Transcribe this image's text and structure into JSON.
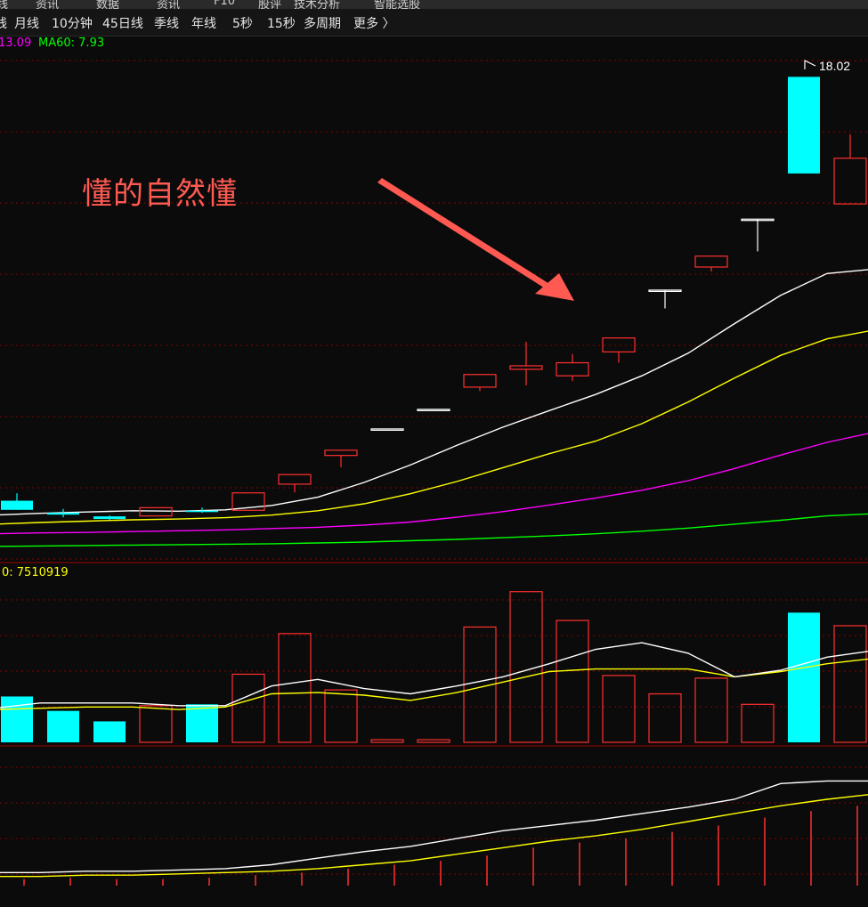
{
  "top_strip": [
    "线",
    "资讯",
    "数据",
    "资讯",
    "F10",
    "股评",
    "技术分析",
    "智能选股"
  ],
  "period_bar": {
    "items": [
      "线",
      "月线",
      "10分钟",
      "45日线",
      "季线",
      "年线",
      "5秒",
      "15秒",
      "多周期",
      "更多 〉"
    ]
  },
  "price_panel": {
    "ma_labels": [
      {
        "text": "13.09",
        "color": "#ff00ff"
      },
      {
        "text": "MA60: 7.93",
        "color": "#00ff00"
      }
    ],
    "high_label": "18.02",
    "annotation": "懂的自然懂"
  },
  "volume_panel": {
    "label": "0: 7510919",
    "label_color": "#ffff00"
  },
  "colors": {
    "up": "#ff3030",
    "down": "#00ffff",
    "ma_white": "#ffffff",
    "ma_yellow": "#ffff00",
    "ma_magenta": "#ff00ff",
    "ma_green": "#00ff00",
    "arrow": "#ff5a52",
    "grid": "#8a0000"
  },
  "chart_data": {
    "type": "candlestick",
    "candles": [
      {
        "o": 8.28,
        "h": 8.45,
        "l": 8.28,
        "c": 8.07,
        "dir": "down"
      },
      {
        "o": 8.0,
        "h": 8.09,
        "l": 7.9,
        "c": 7.96,
        "dir": "down"
      },
      {
        "o": 7.92,
        "h": 7.94,
        "l": 7.84,
        "c": 7.86,
        "dir": "down"
      },
      {
        "o": 7.93,
        "h": 8.12,
        "l": 7.93,
        "c": 8.12,
        "dir": "up"
      },
      {
        "o": 8.05,
        "h": 8.12,
        "l": 8.0,
        "c": 8.03,
        "dir": "down"
      },
      {
        "o": 8.06,
        "h": 8.46,
        "l": 8.06,
        "c": 8.46,
        "dir": "up"
      },
      {
        "o": 8.66,
        "h": 8.88,
        "l": 8.47,
        "c": 8.88,
        "dir": "up"
      },
      {
        "o": 9.32,
        "h": 9.44,
        "l": 9.05,
        "c": 9.44,
        "dir": "up"
      },
      {
        "o": 9.93,
        "h": 9.93,
        "l": 9.93,
        "c": 9.93,
        "dir": "flat"
      },
      {
        "o": 10.38,
        "h": 10.38,
        "l": 10.38,
        "c": 10.38,
        "dir": "flat"
      },
      {
        "o": 10.89,
        "h": 11.18,
        "l": 10.8,
        "c": 11.18,
        "dir": "up"
      },
      {
        "o": 11.3,
        "h": 11.93,
        "l": 10.93,
        "c": 11.38,
        "dir": "up"
      },
      {
        "o": 11.15,
        "h": 11.65,
        "l": 11.03,
        "c": 11.45,
        "dir": "up"
      },
      {
        "o": 11.7,
        "h": 12.02,
        "l": 11.45,
        "c": 12.02,
        "dir": "up"
      },
      {
        "o": 13.12,
        "h": 13.12,
        "l": 12.7,
        "c": 13.12,
        "dir": "flat"
      },
      {
        "o": 13.65,
        "h": 13.9,
        "l": 13.55,
        "c": 13.9,
        "dir": "up"
      },
      {
        "o": 14.75,
        "h": 14.75,
        "l": 14.01,
        "c": 14.75,
        "dir": "flat"
      },
      {
        "o": 18.02,
        "h": 18.02,
        "l": 15.8,
        "c": 15.8,
        "dir": "down"
      },
      {
        "o": 15.1,
        "h": 16.7,
        "l": 15.1,
        "c": 16.15,
        "dir": "up"
      }
    ],
    "ma_white": [
      7.95,
      7.99,
      8.02,
      8.05,
      8.04,
      8.07,
      8.17,
      8.36,
      8.7,
      9.1,
      9.55,
      9.97,
      10.35,
      10.72,
      11.15,
      11.67,
      12.35,
      13.0,
      13.5,
      13.6
    ],
    "ma_yellow": [
      7.74,
      7.78,
      7.81,
      7.84,
      7.86,
      7.89,
      7.95,
      8.05,
      8.21,
      8.44,
      8.72,
      9.04,
      9.36,
      9.65,
      10.05,
      10.55,
      11.1,
      11.62,
      12.0,
      12.2
    ],
    "ma_magenta": [
      7.52,
      7.54,
      7.55,
      7.57,
      7.59,
      7.61,
      7.64,
      7.67,
      7.72,
      7.79,
      7.9,
      8.03,
      8.18,
      8.34,
      8.52,
      8.74,
      9.02,
      9.33,
      9.62,
      9.85
    ],
    "ma_green": [
      7.23,
      7.24,
      7.25,
      7.26,
      7.27,
      7.28,
      7.29,
      7.31,
      7.33,
      7.36,
      7.39,
      7.43,
      7.47,
      7.52,
      7.58,
      7.65,
      7.74,
      7.83,
      7.93,
      7.98
    ],
    "price_ylim": [
      6.9,
      18.6
    ],
    "volume": [
      0.35,
      0.24,
      0.16,
      0.28,
      0.29,
      0.52,
      0.83,
      0.4,
      0.02,
      0.02,
      0.88,
      1.15,
      0.93,
      0.51,
      0.37,
      0.49,
      0.29,
      0.99,
      0.89
    ],
    "volume_ma_white": [
      0.26,
      0.3,
      0.3,
      0.3,
      0.28,
      0.28,
      0.43,
      0.48,
      0.41,
      0.37,
      0.43,
      0.5,
      0.6,
      0.71,
      0.76,
      0.68,
      0.5,
      0.55,
      0.65,
      0.7
    ],
    "volume_ma_yellow": [
      0.25,
      0.26,
      0.27,
      0.27,
      0.25,
      0.27,
      0.37,
      0.38,
      0.36,
      0.32,
      0.38,
      0.46,
      0.54,
      0.56,
      0.56,
      0.56,
      0.5,
      0.54,
      0.6,
      0.64
    ],
    "volume_max": 1.25,
    "lower_ind_white": [
      0.1,
      0.1,
      0.11,
      0.11,
      0.12,
      0.13,
      0.16,
      0.21,
      0.26,
      0.3,
      0.36,
      0.42,
      0.46,
      0.5,
      0.55,
      0.6,
      0.66,
      0.78,
      0.8,
      0.8
    ],
    "lower_ind_yellow": [
      0.07,
      0.07,
      0.08,
      0.08,
      0.09,
      0.1,
      0.11,
      0.13,
      0.16,
      0.19,
      0.24,
      0.29,
      0.34,
      0.38,
      0.43,
      0.49,
      0.55,
      0.61,
      0.66,
      0.7
    ],
    "lower_ind_bars": [
      0.05,
      0.06,
      0.05,
      0.05,
      0.06,
      0.08,
      0.1,
      0.13,
      0.16,
      0.19,
      0.23,
      0.29,
      0.33,
      0.36,
      0.41,
      0.46,
      0.52,
      0.57,
      0.61,
      0.63
    ]
  }
}
